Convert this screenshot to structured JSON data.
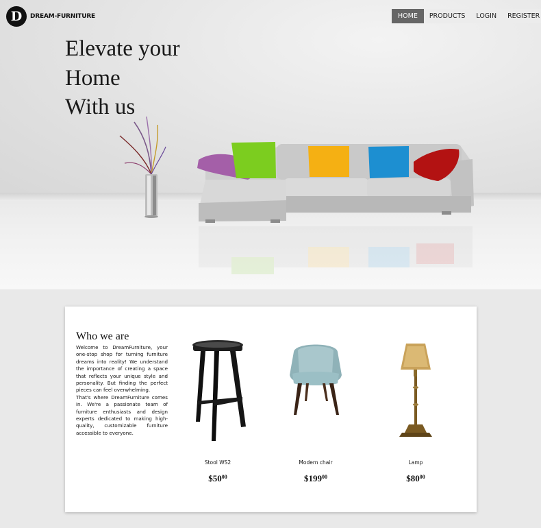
{
  "brand": {
    "logo_letter": "D",
    "name": "DREAM-FURNITURE"
  },
  "nav": [
    {
      "label": "HOME",
      "active": true
    },
    {
      "label": "PRODUCTS",
      "active": false
    },
    {
      "label": "LOGIN",
      "active": false
    },
    {
      "label": "REGISTER",
      "active": false
    }
  ],
  "hero": {
    "headline": [
      "Elevate your",
      "Home",
      "With us"
    ],
    "pillow_colors": [
      "#a45fa8",
      "#7ccd1f",
      "#f5b013",
      "#1d8fd1",
      "#b31212"
    ]
  },
  "about": {
    "title": "Who we are",
    "body": "Welcome to DreamFurniture, your one-stop shop for turning furniture dreams into reality! We understand the importance of creating a space that reflects your unique style and personality. But finding the perfect pieces can feel overwhelming.",
    "body2": "That's where DreamFurniture comes in. We're a passionate team of furniture enthusiasts and design experts dedicated to making high-quality, customizable furniture accessible to everyone."
  },
  "products": [
    {
      "name": "Stool WS2",
      "price_main": "$50",
      "price_cents": "00",
      "icon": "stool-image"
    },
    {
      "name": "Modern chair",
      "price_main": "$199",
      "price_cents": "00",
      "icon": "chair-image"
    },
    {
      "name": "Lamp",
      "price_main": "$80",
      "price_cents": "00",
      "icon": "lamp-image"
    }
  ]
}
